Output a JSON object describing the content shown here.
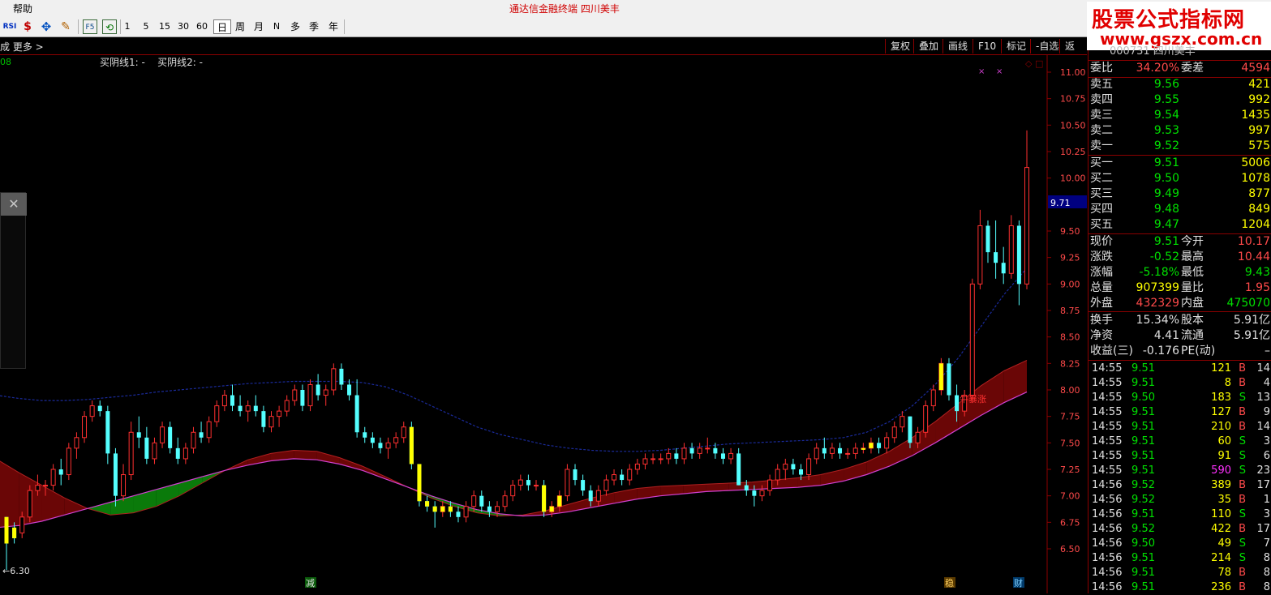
{
  "menubar": {
    "help": "帮助",
    "title": "通达信金融终端    四川美丰"
  },
  "toolbar": {
    "icons": [
      "RSI",
      "$",
      "✥",
      "✎",
      "F5",
      "⟲"
    ],
    "periods": [
      "1",
      "5",
      "15",
      "30",
      "60",
      "日",
      "周",
      "月",
      "N",
      "多",
      "季",
      "年"
    ],
    "selected": "日"
  },
  "brand": {
    "line1": "股票公式指标网",
    "line2": "www.gszx.com.cn"
  },
  "tabbar": {
    "more": "成  更多 >",
    "buttons": [
      "复权",
      "叠加",
      "画线",
      "F10",
      "标记",
      "-自选",
      "返回"
    ]
  },
  "chart": {
    "indicator_text": "买阴线1: -    买阴线2: -",
    "left_marker": "08",
    "y_ticks": [
      "11.00",
      "10.75",
      "10.50",
      "10.25",
      "10.00",
      "9.71",
      "9.50",
      "9.25",
      "9.00",
      "8.75",
      "8.50",
      "8.25",
      "8.00",
      "7.75",
      "7.50",
      "7.25",
      "7.00",
      "6.75",
      "6.50"
    ],
    "current_price_label": "9.71",
    "low_label": "←6.30",
    "annotation": "牛暴涨",
    "bottom_markers": [
      "减",
      "稳",
      "财"
    ]
  },
  "chart_data": {
    "type": "candlestick",
    "price_unit": "CNY",
    "ylim": [
      6.3,
      11.2
    ],
    "x_count": 126,
    "candles": [
      [
        6.8,
        6.8,
        6.3,
        6.55
      ],
      [
        6.7,
        6.75,
        6.55,
        6.6
      ],
      [
        6.65,
        6.85,
        6.6,
        6.8
      ],
      [
        6.8,
        7.1,
        6.75,
        7.05
      ],
      [
        7.05,
        7.2,
        7.0,
        7.1
      ],
      [
        7.1,
        7.15,
        7.0,
        7.1
      ],
      [
        7.1,
        7.3,
        7.05,
        7.25
      ],
      [
        7.25,
        7.35,
        7.1,
        7.2
      ],
      [
        7.2,
        7.5,
        7.15,
        7.45
      ],
      [
        7.45,
        7.6,
        7.35,
        7.55
      ],
      [
        7.55,
        7.8,
        7.5,
        7.75
      ],
      [
        7.75,
        7.9,
        7.7,
        7.85
      ],
      [
        7.85,
        7.9,
        7.75,
        7.8
      ],
      [
        7.8,
        7.85,
        7.3,
        7.4
      ],
      [
        7.4,
        7.45,
        6.9,
        7.0
      ],
      [
        7.0,
        7.3,
        6.95,
        7.2
      ],
      [
        7.2,
        7.7,
        7.15,
        7.6
      ],
      [
        7.6,
        7.75,
        7.45,
        7.55
      ],
      [
        7.55,
        7.65,
        7.3,
        7.35
      ],
      [
        7.35,
        7.55,
        7.3,
        7.5
      ],
      [
        7.5,
        7.7,
        7.45,
        7.65
      ],
      [
        7.65,
        7.7,
        7.4,
        7.45
      ],
      [
        7.45,
        7.55,
        7.3,
        7.35
      ],
      [
        7.35,
        7.5,
        7.3,
        7.45
      ],
      [
        7.45,
        7.65,
        7.4,
        7.6
      ],
      [
        7.6,
        7.7,
        7.5,
        7.55
      ],
      [
        7.55,
        7.75,
        7.5,
        7.7
      ],
      [
        7.7,
        7.9,
        7.65,
        7.85
      ],
      [
        7.85,
        8.0,
        7.8,
        7.95
      ],
      [
        7.95,
        8.05,
        7.8,
        7.85
      ],
      [
        7.85,
        7.95,
        7.75,
        7.8
      ],
      [
        7.8,
        7.9,
        7.7,
        7.85
      ],
      [
        7.85,
        7.95,
        7.75,
        7.8
      ],
      [
        7.8,
        7.85,
        7.6,
        7.65
      ],
      [
        7.65,
        7.8,
        7.6,
        7.75
      ],
      [
        7.75,
        7.85,
        7.65,
        7.8
      ],
      [
        7.8,
        7.95,
        7.75,
        7.9
      ],
      [
        7.9,
        8.05,
        7.85,
        8.0
      ],
      [
        8.0,
        8.05,
        7.8,
        7.85
      ],
      [
        7.85,
        8.1,
        7.8,
        8.05
      ],
      [
        8.05,
        8.15,
        7.9,
        7.95
      ],
      [
        7.95,
        8.05,
        7.85,
        8.0
      ],
      [
        8.0,
        8.25,
        7.95,
        8.2
      ],
      [
        8.2,
        8.25,
        8.0,
        8.05
      ],
      [
        8.05,
        8.1,
        7.9,
        7.95
      ],
      [
        7.95,
        8.1,
        7.55,
        7.6
      ],
      [
        7.6,
        7.65,
        7.5,
        7.55
      ],
      [
        7.55,
        7.6,
        7.45,
        7.5
      ],
      [
        7.5,
        7.55,
        7.4,
        7.45
      ],
      [
        7.45,
        7.55,
        7.35,
        7.5
      ],
      [
        7.5,
        7.6,
        7.45,
        7.55
      ],
      [
        7.55,
        7.7,
        7.5,
        7.65
      ],
      [
        7.65,
        7.7,
        7.25,
        7.3
      ],
      [
        7.3,
        7.3,
        6.9,
        6.95
      ],
      [
        6.95,
        7.0,
        6.85,
        6.9
      ],
      [
        6.9,
        6.95,
        6.7,
        6.85
      ],
      [
        6.85,
        6.95,
        6.8,
        6.9
      ],
      [
        6.9,
        6.95,
        6.8,
        6.85
      ],
      [
        6.85,
        6.9,
        6.75,
        6.8
      ],
      [
        6.8,
        6.95,
        6.75,
        6.9
      ],
      [
        6.9,
        7.05,
        6.85,
        7.0
      ],
      [
        7.0,
        7.05,
        6.85,
        6.9
      ],
      [
        6.9,
        6.95,
        6.8,
        6.85
      ],
      [
        6.85,
        6.95,
        6.8,
        6.9
      ],
      [
        6.9,
        7.05,
        6.85,
        7.0
      ],
      [
        7.0,
        7.15,
        6.95,
        7.1
      ],
      [
        7.1,
        7.2,
        7.05,
        7.15
      ],
      [
        7.15,
        7.2,
        7.05,
        7.1
      ],
      [
        7.1,
        7.15,
        7.05,
        7.1
      ],
      [
        7.1,
        7.15,
        6.8,
        6.85
      ],
      [
        6.85,
        6.95,
        6.8,
        6.9
      ],
      [
        6.9,
        7.05,
        6.85,
        7.0
      ],
      [
        7.0,
        7.3,
        6.95,
        7.25
      ],
      [
        7.25,
        7.3,
        7.1,
        7.15
      ],
      [
        7.15,
        7.2,
        7.0,
        7.05
      ],
      [
        7.05,
        7.1,
        6.9,
        6.95
      ],
      [
        6.95,
        7.1,
        6.9,
        7.05
      ],
      [
        7.05,
        7.2,
        7.0,
        7.15
      ],
      [
        7.15,
        7.25,
        7.1,
        7.2
      ],
      [
        7.2,
        7.25,
        7.1,
        7.15
      ],
      [
        7.15,
        7.3,
        7.1,
        7.25
      ],
      [
        7.25,
        7.35,
        7.2,
        7.3
      ],
      [
        7.3,
        7.4,
        7.25,
        7.35
      ],
      [
        7.35,
        7.4,
        7.3,
        7.35
      ],
      [
        7.35,
        7.4,
        7.3,
        7.35
      ],
      [
        7.35,
        7.45,
        7.3,
        7.4
      ],
      [
        7.4,
        7.45,
        7.3,
        7.35
      ],
      [
        7.35,
        7.5,
        7.3,
        7.45
      ],
      [
        7.45,
        7.5,
        7.35,
        7.4
      ],
      [
        7.4,
        7.5,
        7.35,
        7.45
      ],
      [
        7.45,
        7.55,
        7.4,
        7.45
      ],
      [
        7.45,
        7.5,
        7.35,
        7.4
      ],
      [
        7.4,
        7.45,
        7.3,
        7.35
      ],
      [
        7.35,
        7.45,
        7.3,
        7.4
      ],
      [
        7.4,
        7.45,
        7.1,
        7.1
      ],
      [
        7.1,
        7.15,
        7.0,
        7.05
      ],
      [
        7.05,
        7.1,
        6.9,
        7.0
      ],
      [
        7.0,
        7.1,
        6.95,
        7.05
      ],
      [
        7.05,
        7.2,
        7.0,
        7.15
      ],
      [
        7.15,
        7.3,
        7.1,
        7.25
      ],
      [
        7.25,
        7.35,
        7.15,
        7.3
      ],
      [
        7.3,
        7.35,
        7.2,
        7.25
      ],
      [
        7.25,
        7.3,
        7.15,
        7.2
      ],
      [
        7.2,
        7.4,
        7.15,
        7.35
      ],
      [
        7.35,
        7.5,
        7.3,
        7.45
      ],
      [
        7.45,
        7.55,
        7.35,
        7.4
      ],
      [
        7.4,
        7.5,
        7.35,
        7.45
      ],
      [
        7.45,
        7.5,
        7.35,
        7.4
      ],
      [
        7.4,
        7.45,
        7.35,
        7.4
      ],
      [
        7.4,
        7.5,
        7.35,
        7.45
      ],
      [
        7.45,
        7.5,
        7.4,
        7.45
      ],
      [
        7.45,
        7.55,
        7.4,
        7.5
      ],
      [
        7.5,
        7.55,
        7.4,
        7.45
      ],
      [
        7.45,
        7.6,
        7.4,
        7.55
      ],
      [
        7.55,
        7.7,
        7.5,
        7.65
      ],
      [
        7.65,
        7.8,
        7.6,
        7.75
      ],
      [
        7.75,
        7.75,
        7.45,
        7.5
      ],
      [
        7.5,
        7.65,
        7.45,
        7.6
      ],
      [
        7.6,
        7.9,
        7.55,
        7.85
      ],
      [
        7.85,
        8.05,
        7.8,
        8.0
      ],
      [
        8.0,
        8.3,
        7.95,
        8.25
      ],
      [
        8.25,
        8.3,
        7.9,
        7.95
      ],
      [
        7.95,
        8.05,
        7.7,
        7.8
      ],
      [
        7.8,
        8.0,
        7.75,
        7.95
      ],
      [
        7.95,
        9.05,
        7.9,
        9.0
      ],
      [
        9.0,
        9.7,
        8.95,
        9.55
      ],
      [
        9.55,
        9.6,
        9.2,
        9.3
      ],
      [
        9.3,
        9.6,
        9.05,
        9.2
      ],
      [
        9.2,
        9.35,
        9.0,
        9.1
      ],
      [
        9.1,
        9.65,
        9.05,
        9.55
      ],
      [
        9.55,
        9.6,
        8.8,
        9.0
      ],
      [
        9.0,
        10.45,
        8.95,
        10.1
      ]
    ],
    "upper_band": [
      7.95,
      7.92,
      7.9,
      7.9,
      7.91,
      7.93,
      7.95,
      7.98,
      8.0,
      8.02,
      8.04,
      8.06,
      8.07,
      8.08,
      8.08,
      8.08,
      8.07,
      8.03,
      7.95,
      7.85,
      7.75,
      7.65,
      7.58,
      7.53,
      7.48,
      7.45,
      7.43,
      7.42,
      7.42,
      7.43,
      7.45,
      7.47,
      7.49,
      7.5,
      7.51,
      7.52,
      7.53,
      7.55,
      7.6,
      7.7,
      7.85,
      8.05,
      8.3,
      8.6,
      8.9,
      9.15
    ],
    "middle_line": [
      7.35,
      7.22,
      7.1,
      6.98,
      6.88,
      6.82,
      6.84,
      6.9,
      7.0,
      7.12,
      7.24,
      7.34,
      7.4,
      7.43,
      7.42,
      7.36,
      7.28,
      7.18,
      7.08,
      6.98,
      6.9,
      6.84,
      6.81,
      6.82,
      6.86,
      6.92,
      6.98,
      7.03,
      7.07,
      7.09,
      7.1,
      7.11,
      7.12,
      7.13,
      7.15,
      7.17,
      7.2,
      7.25,
      7.32,
      7.42,
      7.55,
      7.7,
      7.87,
      8.04,
      8.18,
      8.28
    ],
    "lower_line": [
      6.7,
      6.72,
      6.76,
      6.82,
      6.88,
      6.94,
      7.0,
      7.06,
      7.12,
      7.18,
      7.24,
      7.29,
      7.33,
      7.35,
      7.34,
      7.3,
      7.24,
      7.16,
      7.08,
      7.0,
      6.93,
      6.87,
      6.83,
      6.81,
      6.82,
      6.85,
      6.89,
      6.93,
      6.97,
      7.0,
      7.02,
      7.04,
      7.05,
      7.06,
      7.07,
      7.08,
      7.1,
      7.14,
      7.2,
      7.28,
      7.38,
      7.5,
      7.63,
      7.76,
      7.88,
      7.98
    ]
  },
  "quote": {
    "header": "000731  四川美丰",
    "weibi": {
      "label": "委比",
      "value": "34.20%",
      "label2": "委差",
      "value2": "4594"
    },
    "sells": [
      {
        "label": "卖五",
        "price": "9.56",
        "vol": "421"
      },
      {
        "label": "卖四",
        "price": "9.55",
        "vol": "992"
      },
      {
        "label": "卖三",
        "price": "9.54",
        "vol": "1435"
      },
      {
        "label": "卖二",
        "price": "9.53",
        "vol": "997"
      },
      {
        "label": "卖一",
        "price": "9.52",
        "vol": "575"
      }
    ],
    "buys": [
      {
        "label": "买一",
        "price": "9.51",
        "vol": "5006"
      },
      {
        "label": "买二",
        "price": "9.50",
        "vol": "1078"
      },
      {
        "label": "买三",
        "price": "9.49",
        "vol": "877"
      },
      {
        "label": "买四",
        "price": "9.48",
        "vol": "849"
      },
      {
        "label": "买五",
        "price": "9.47",
        "vol": "1204"
      }
    ],
    "stats": [
      {
        "l1": "现价",
        "v1": "9.51",
        "c1": "grn",
        "l2": "今开",
        "v2": "10.17",
        "c2": "red"
      },
      {
        "l1": "涨跌",
        "v1": "-0.52",
        "c1": "grn",
        "l2": "最高",
        "v2": "10.44",
        "c2": "red"
      },
      {
        "l1": "涨幅",
        "v1": "-5.18%",
        "c1": "grn",
        "l2": "最低",
        "v2": "9.43",
        "c2": "grn"
      },
      {
        "l1": "总量",
        "v1": "907399",
        "c1": "yel",
        "l2": "量比",
        "v2": "1.95",
        "c2": "red"
      },
      {
        "l1": "外盘",
        "v1": "432329",
        "c1": "red",
        "l2": "内盘",
        "v2": "475070",
        "c2": "grn"
      }
    ],
    "fund": [
      {
        "l1": "换手",
        "v1": "15.34%",
        "l2": "股本",
        "v2": "5.91亿"
      },
      {
        "l1": "净资",
        "v1": "4.41",
        "l2": "流通",
        "v2": "5.91亿"
      },
      {
        "l1": "收益(三)",
        "v1": "-0.176",
        "l2": "PE(动)",
        "v2": "–"
      }
    ],
    "trades": [
      {
        "time": "14:55",
        "price": "9.51",
        "vol": "121",
        "bs": "B",
        "n": "14"
      },
      {
        "time": "14:55",
        "price": "9.51",
        "vol": "8",
        "bs": "B",
        "n": "4"
      },
      {
        "time": "14:55",
        "price": "9.50",
        "vol": "183",
        "bs": "S",
        "n": "13"
      },
      {
        "time": "14:55",
        "price": "9.51",
        "vol": "127",
        "bs": "B",
        "n": "9"
      },
      {
        "time": "14:55",
        "price": "9.51",
        "vol": "210",
        "bs": "B",
        "n": "14"
      },
      {
        "time": "14:55",
        "price": "9.51",
        "vol": "60",
        "bs": "S",
        "n": "3"
      },
      {
        "time": "14:55",
        "price": "9.51",
        "vol": "91",
        "bs": "S",
        "n": "6"
      },
      {
        "time": "14:55",
        "price": "9.51",
        "vol": "590",
        "bs": "S",
        "n": "23",
        "big": true
      },
      {
        "time": "14:56",
        "price": "9.52",
        "vol": "389",
        "bs": "B",
        "n": "17"
      },
      {
        "time": "14:56",
        "price": "9.52",
        "vol": "35",
        "bs": "B",
        "n": "1"
      },
      {
        "time": "14:56",
        "price": "9.51",
        "vol": "110",
        "bs": "S",
        "n": "3"
      },
      {
        "time": "14:56",
        "price": "9.52",
        "vol": "422",
        "bs": "B",
        "n": "17"
      },
      {
        "time": "14:56",
        "price": "9.50",
        "vol": "49",
        "bs": "S",
        "n": "7"
      },
      {
        "time": "14:56",
        "price": "9.51",
        "vol": "214",
        "bs": "S",
        "n": "8"
      },
      {
        "time": "14:56",
        "price": "9.51",
        "vol": "78",
        "bs": "B",
        "n": "8"
      },
      {
        "time": "14:56",
        "price": "9.51",
        "vol": "236",
        "bs": "B",
        "n": "8"
      }
    ]
  },
  "colors": {
    "up": "#ff3030",
    "down": "#54ffff",
    "green_fill": "#0a7a0a",
    "red_fill": "#6a0606",
    "band": "#1a2a9a",
    "lower": "#d040d0",
    "signal": "#ffff00"
  }
}
